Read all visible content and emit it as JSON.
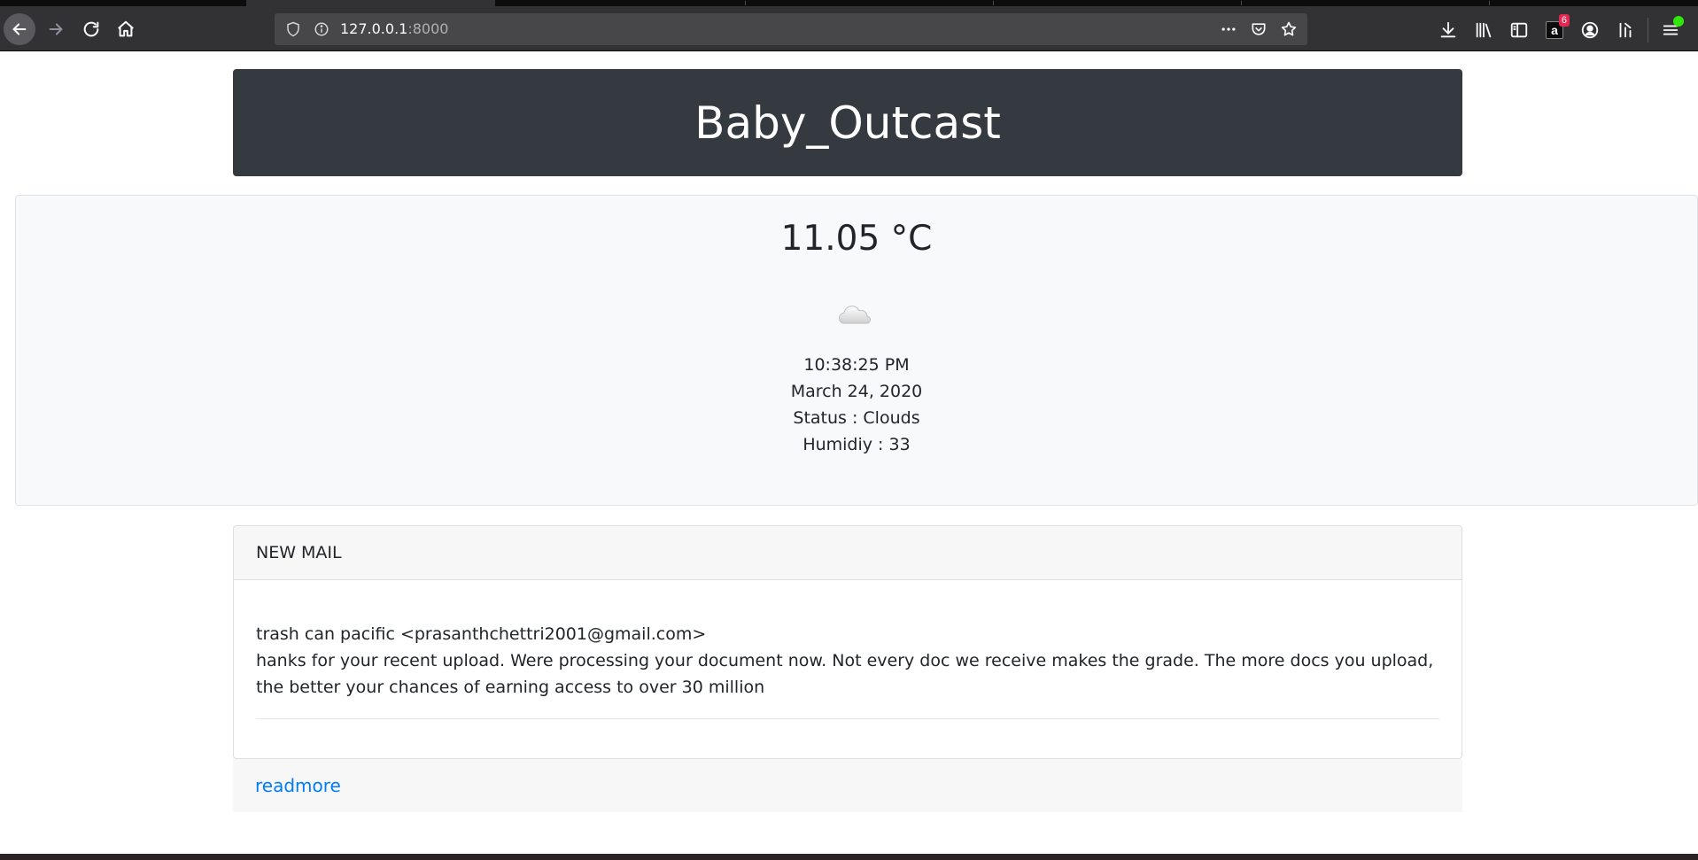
{
  "browser": {
    "url_host": "127.0.0.1",
    "url_port": ":8000",
    "extension_badge": "6",
    "amazon_letter": "a"
  },
  "app": {
    "title": "Baby_Outcast"
  },
  "weather": {
    "temperature": "11.05 °C",
    "icon": "cloud-icon",
    "time": "10:38:25 PM",
    "date": "March 24, 2020",
    "status": "Status : Clouds",
    "humidity": "Humidiy : 33"
  },
  "mail": {
    "header": "NEW MAIL",
    "sender": "trash can pacific <prasanthchettri2001@gmail.com>",
    "body": "hanks for your recent upload. Were processing your document now. Not every doc we receive makes the grade. The more docs you upload, the better your chances of earning access to over 30 million",
    "readmore_label": "readmore"
  },
  "colors": {
    "header_bg": "#343a40",
    "link": "#007bff",
    "card_bg": "#f8f9fa"
  }
}
